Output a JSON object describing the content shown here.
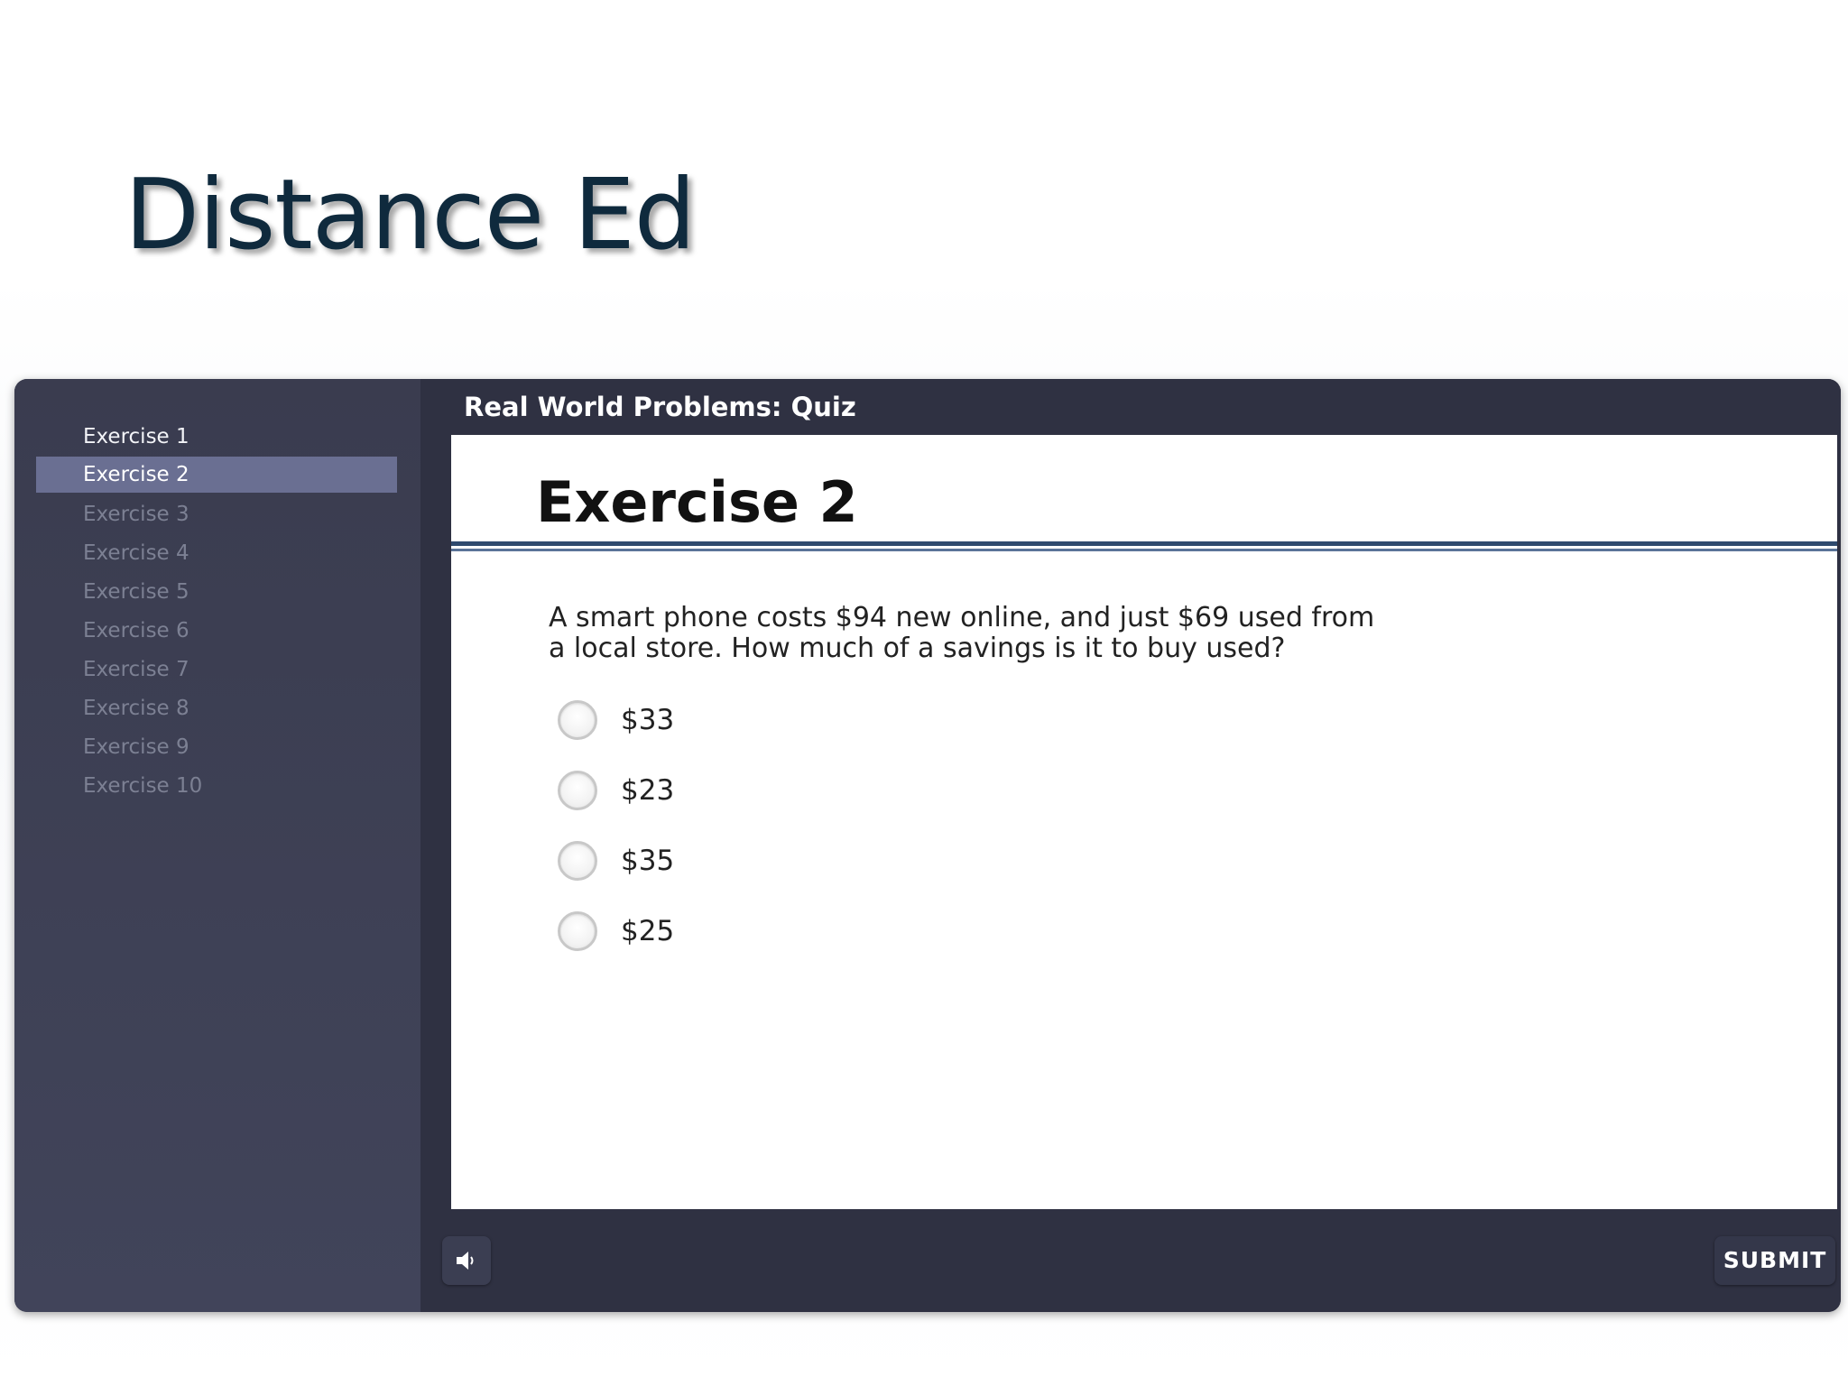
{
  "slide": {
    "title": "Distance Ed"
  },
  "sidebar": {
    "items": [
      {
        "label": "Exercise 1",
        "state": "completed"
      },
      {
        "label": "Exercise 2",
        "state": "active"
      },
      {
        "label": "Exercise 3",
        "state": "locked"
      },
      {
        "label": "Exercise 4",
        "state": "locked"
      },
      {
        "label": "Exercise 5",
        "state": "locked"
      },
      {
        "label": "Exercise 6",
        "state": "locked"
      },
      {
        "label": "Exercise 7",
        "state": "locked"
      },
      {
        "label": "Exercise 8",
        "state": "locked"
      },
      {
        "label": "Exercise 9",
        "state": "locked"
      },
      {
        "label": "Exercise 10",
        "state": "locked"
      }
    ]
  },
  "main": {
    "quiz_title": "Real World Problems: Quiz",
    "exercise_heading": "Exercise 2",
    "question_line1": "A smart phone costs $94 new online, and just $69 used from",
    "question_line2": "a local store. How much of a savings is it to buy used?",
    "options": [
      {
        "label": "$33",
        "selected": false
      },
      {
        "label": "$23",
        "selected": false
      },
      {
        "label": "$35",
        "selected": false
      },
      {
        "label": "$25",
        "selected": false
      }
    ]
  },
  "footer": {
    "sound_icon": "speaker-icon",
    "submit_label": "SUBMIT"
  },
  "colors": {
    "title": "#0f2a3d",
    "sidebar_active": "#6a6f92",
    "player_bg": "#2f3142",
    "rule": "#2f4a6e"
  }
}
